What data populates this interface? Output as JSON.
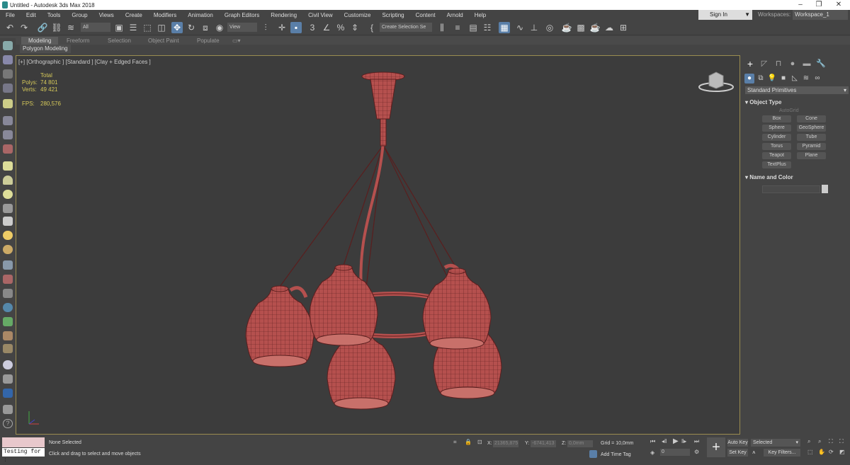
{
  "window": {
    "title": "Untitled - Autodesk 3ds Max 2018",
    "minimize": "–",
    "restore": "❐",
    "close": "✕"
  },
  "menu": [
    "File",
    "Edit",
    "Tools",
    "Group",
    "Views",
    "Create",
    "Modifiers",
    "Animation",
    "Graph Editors",
    "Rendering",
    "Civil View",
    "Customize",
    "Scripting",
    "Content",
    "Arnold",
    "Help"
  ],
  "account": {
    "sign_in": "Sign In",
    "workspaces_label": "Workspaces:",
    "workspace": "Workspace_1"
  },
  "toolbar": {
    "filter": "All",
    "ref_coord": "View",
    "selection_set": "Create Selection Se"
  },
  "ribbon": {
    "tabs": [
      "Modeling",
      "Freeform",
      "Selection",
      "Object Paint",
      "Populate"
    ],
    "active": "Modeling",
    "panel": "Polygon Modeling"
  },
  "viewport": {
    "label": "[+] [Orthographic ] [Standard ] [Clay + Edged Faces ]",
    "stats": {
      "header": "Total",
      "polys_label": "Polys:",
      "polys": "74 801",
      "verts_label": "Verts:",
      "verts": "49 421",
      "fps_label": "FPS:",
      "fps": "280,576"
    },
    "model_color": "#b5504e",
    "wire_color": "#5a1e1e"
  },
  "command_panel": {
    "category": "Standard Primitives",
    "object_type": "Object Type",
    "autogrid": "AutoGrid",
    "buttons": [
      "Box",
      "Cone",
      "Sphere",
      "GeoSphere",
      "Cylinder",
      "Tube",
      "Torus",
      "Pyramid",
      "Teapot",
      "Plane",
      "TextPlus"
    ],
    "name_and_color": "Name and Color"
  },
  "status": {
    "maxscript": "Testing for :",
    "selection": "None Selected",
    "prompt": "Click and drag to select and move objects",
    "x_label": "X:",
    "x": "21365,875",
    "y_label": "Y:",
    "y": "-6741,413",
    "z_label": "Z:",
    "z": "0,0mm",
    "grid": "Grid = 10,0mm",
    "add_time_tag": "Add Time Tag",
    "frame": "0",
    "auto_key": "Auto Key",
    "set_key": "Set Key",
    "key_mode": "Selected",
    "key_filters": "Key Filters..."
  }
}
